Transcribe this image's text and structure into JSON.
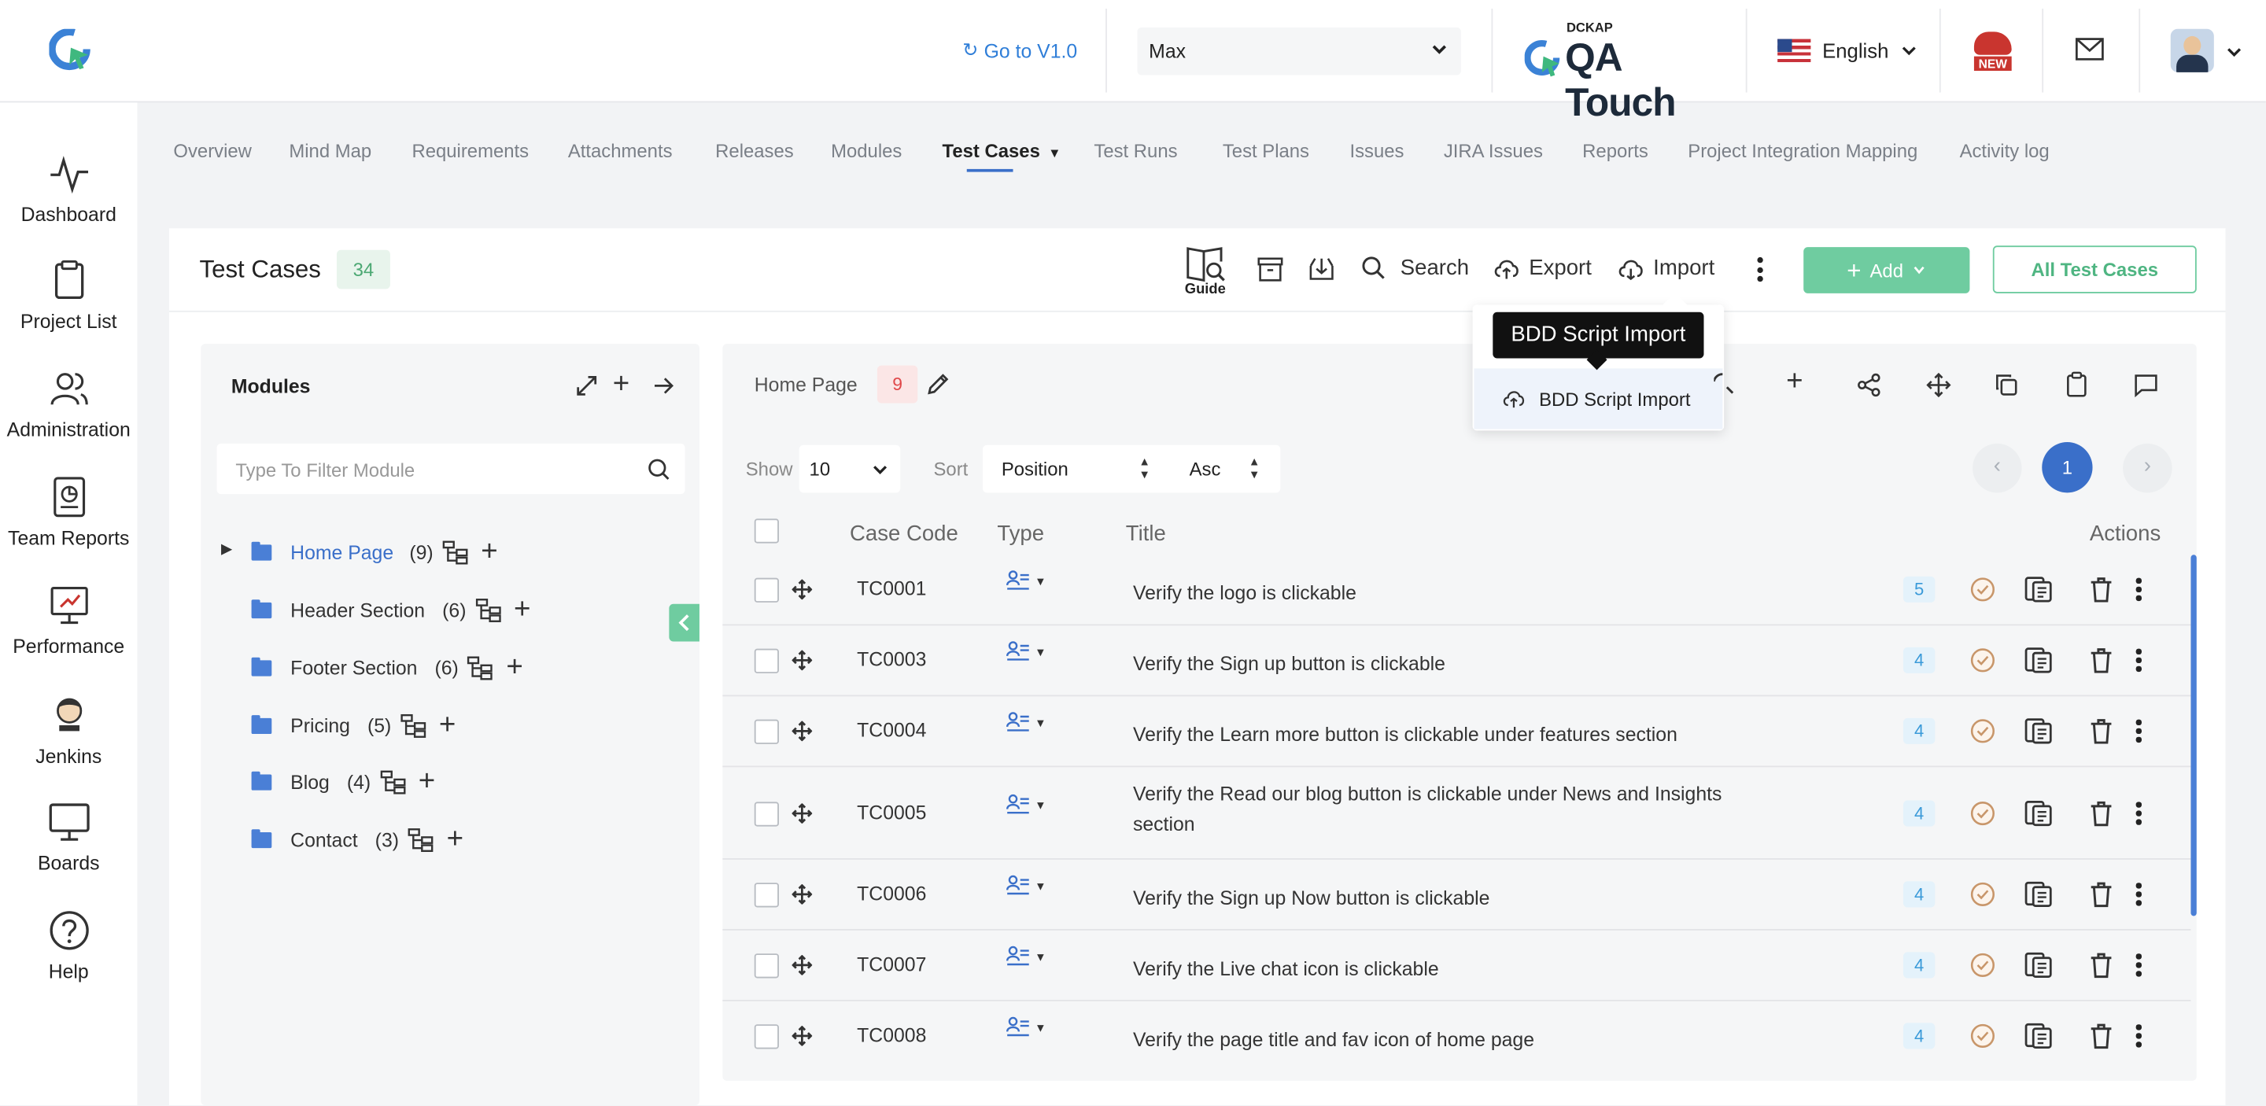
{
  "topbar": {
    "goto_label": "Go to V1.0",
    "project_select": "Max",
    "brand_small": "DCKAP",
    "brand_name": "QA Touch",
    "language": "English",
    "new_badge": "NEW"
  },
  "sidebar": {
    "items": [
      {
        "label": "Dashboard",
        "icon": "pulse-icon"
      },
      {
        "label": "Project List",
        "icon": "clipboard-icon"
      },
      {
        "label": "Administration",
        "icon": "users-icon"
      },
      {
        "label": "Team Reports",
        "icon": "report-icon"
      },
      {
        "label": "Performance",
        "icon": "performance-icon"
      },
      {
        "label": "Jenkins",
        "icon": "jenkins-icon"
      },
      {
        "label": "Boards",
        "icon": "monitor-icon"
      },
      {
        "label": "Help",
        "icon": "help-icon"
      }
    ]
  },
  "tabs": [
    "Overview",
    "Mind Map",
    "Requirements",
    "Attachments",
    "Releases",
    "Modules",
    "Test Cases",
    "Test Runs",
    "Test Plans",
    "Issues",
    "JIRA Issues",
    "Reports",
    "Project Integration Mapping",
    "Activity log"
  ],
  "active_tab": "Test Cases",
  "header": {
    "title": "Test Cases",
    "count": "34",
    "guide": "Guide",
    "search": "Search",
    "export": "Export",
    "import": "Import",
    "add": "Add",
    "all_cases": "All Test Cases"
  },
  "import_menu": {
    "tooltip": "BDD Script Import",
    "item": "BDD Script Import"
  },
  "modules": {
    "title": "Modules",
    "filter_placeholder": "Type To Filter Module",
    "items": [
      {
        "name": "Home Page",
        "count": "(9)",
        "active": true
      },
      {
        "name": "Header Section",
        "count": "(6)"
      },
      {
        "name": "Footer Section",
        "count": "(6)"
      },
      {
        "name": "Pricing",
        "count": "(5)"
      },
      {
        "name": "Blog",
        "count": "(4)"
      },
      {
        "name": "Contact",
        "count": "(3)"
      }
    ]
  },
  "table_panel": {
    "module_name": "Home Page",
    "module_count": "9",
    "show_label": "Show",
    "show_value": "10",
    "sort_label": "Sort",
    "sort_field": "Position",
    "sort_order": "Asc",
    "page": "1",
    "columns": {
      "case_code": "Case Code",
      "type": "Type",
      "title": "Title",
      "actions": "Actions"
    },
    "rows": [
      {
        "code": "TC0001",
        "title": "Verify the logo is clickable",
        "steps": "5"
      },
      {
        "code": "TC0003",
        "title": "Verify the Sign up button is clickable",
        "steps": "4"
      },
      {
        "code": "TC0004",
        "title": "Verify the Learn more button is clickable under features section",
        "steps": "4"
      },
      {
        "code": "TC0005",
        "title": "Verify the Read our blog button is clickable under News and Insights section",
        "steps": "4"
      },
      {
        "code": "TC0006",
        "title": "Verify the Sign up Now button is clickable",
        "steps": "4"
      },
      {
        "code": "TC0007",
        "title": "Verify the Live chat icon is clickable",
        "steps": "4"
      },
      {
        "code": "TC0008",
        "title": "Verify the page title and fav icon of home page",
        "steps": "4"
      }
    ]
  },
  "colors": {
    "accent_green": "#6fcca0",
    "link_blue": "#2f7ed8",
    "nav_blue": "#3a6fc9",
    "badge_red": "#e0484a"
  }
}
